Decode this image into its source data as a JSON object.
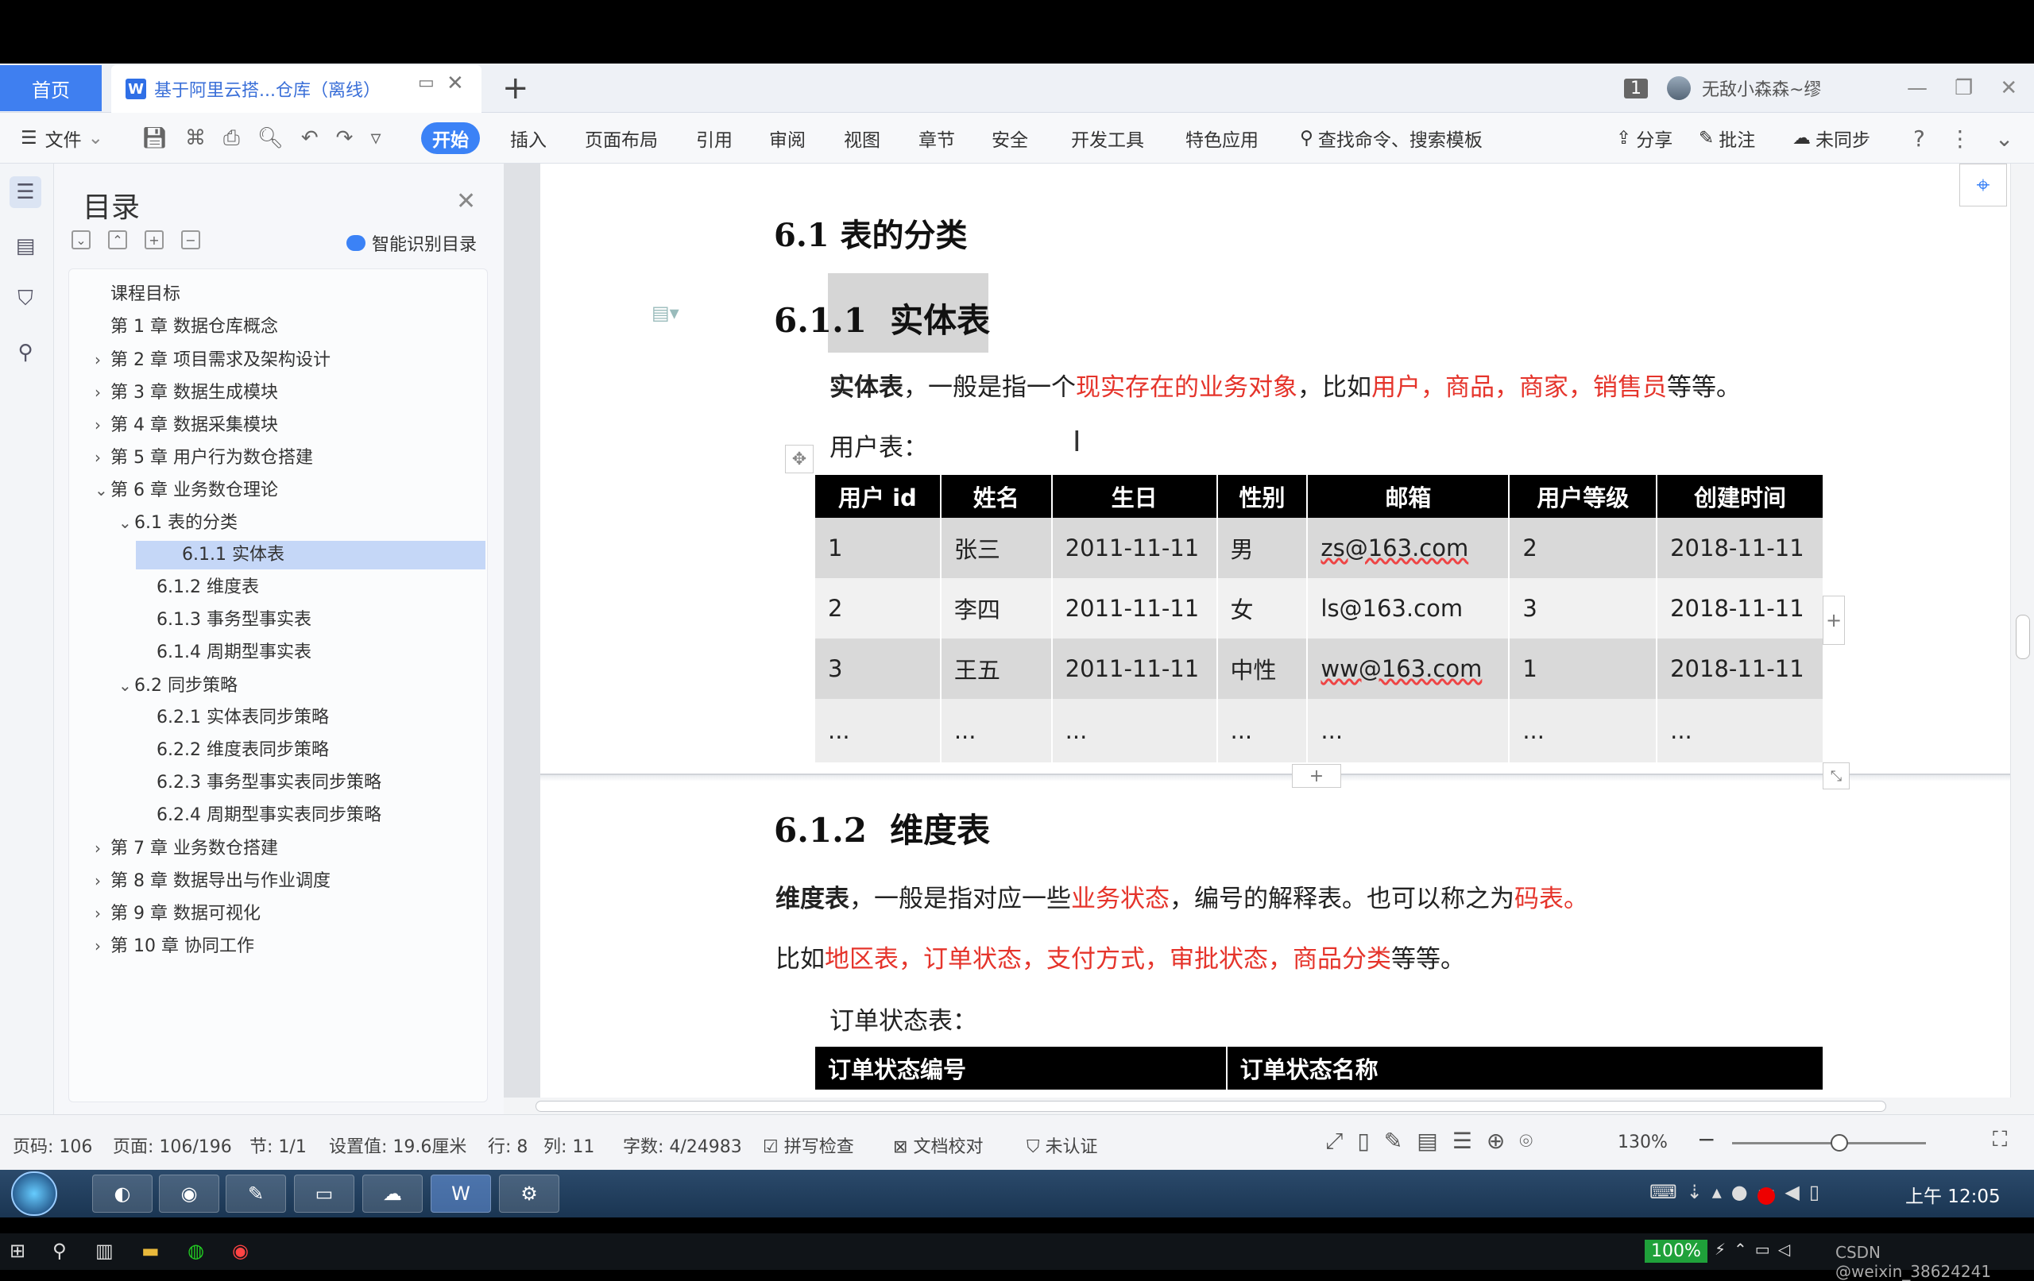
{
  "tabs": {
    "home": "首页",
    "doc": "基于阿里云搭...仓库（离线）",
    "new": "+"
  },
  "window": {
    "badge": "1",
    "user": "无敌小森森~缪"
  },
  "toolbar": {
    "file": "文件",
    "items": [
      "开始",
      "插入",
      "页面布局",
      "引用",
      "审阅",
      "视图",
      "章节",
      "安全",
      "开发工具",
      "特色应用"
    ],
    "search": "查找命令、搜索模板",
    "share": "分享",
    "comment": "批注",
    "sync": "未同步"
  },
  "toc": {
    "title": "目录",
    "smart": "智能识别目录",
    "items": [
      {
        "label": "课程目标",
        "level": 0,
        "arrow": ""
      },
      {
        "label": "第 1 章  数据仓库概念",
        "level": 0,
        "arrow": ""
      },
      {
        "label": "第 2 章  项目需求及架构设计",
        "level": 0,
        "arrow": "›"
      },
      {
        "label": "第 3 章  数据生成模块",
        "level": 0,
        "arrow": "›"
      },
      {
        "label": "第 4 章  数据采集模块",
        "level": 0,
        "arrow": "›"
      },
      {
        "label": "第 5 章  用户行为数仓搭建",
        "level": 0,
        "arrow": "›"
      },
      {
        "label": "第 6 章  业务数仓理论",
        "level": 0,
        "arrow": "⌄"
      },
      {
        "label": "6.1  表的分类",
        "level": 1,
        "arrow": "⌄"
      },
      {
        "label": "6.1.1  实体表",
        "level": 2,
        "arrow": ""
      },
      {
        "label": "6.1.2  维度表",
        "level": 2,
        "arrow": ""
      },
      {
        "label": "6.1.3  事务型事实表",
        "level": 2,
        "arrow": ""
      },
      {
        "label": "6.1.4  周期型事实表",
        "level": 2,
        "arrow": ""
      },
      {
        "label": "6.2  同步策略",
        "level": 1,
        "arrow": "⌄"
      },
      {
        "label": "6.2.1  实体表同步策略",
        "level": 2,
        "arrow": ""
      },
      {
        "label": "6.2.2  维度表同步策略",
        "level": 2,
        "arrow": ""
      },
      {
        "label": "6.2.3  事务型事实表同步策略",
        "level": 2,
        "arrow": ""
      },
      {
        "label": "6.2.4  周期型事实表同步策略",
        "level": 2,
        "arrow": ""
      },
      {
        "label": "第 7 章  业务数仓搭建",
        "level": 0,
        "arrow": "›"
      },
      {
        "label": "第 8 章  数据导出与作业调度",
        "level": 0,
        "arrow": "›"
      },
      {
        "label": "第 9 章  数据可视化",
        "level": 0,
        "arrow": "›"
      },
      {
        "label": "第 10 章  协同工作",
        "level": 0,
        "arrow": "›"
      }
    ],
    "selected_index": 8
  },
  "doc": {
    "h_61": "6.1  表的分类",
    "h_611_num": "6.1.1",
    "h_611_txt": "实体表",
    "p1": {
      "b": "实体表",
      "t1": "，一般是指一个",
      "r1": "现实存在的业务对象",
      "t2": "，比如",
      "r2": "用户，商品，商家，销售员",
      "t3": "等等。"
    },
    "user_table_label": "用户表：",
    "user_table": {
      "headers": [
        "用户 id",
        "姓名",
        "生日",
        "性别",
        "邮箱",
        "用户等级",
        "创建时间"
      ],
      "rows": [
        [
          "1",
          "张三",
          "2011-11-11",
          "男",
          "zs@163.com",
          "2",
          "2018-11-11"
        ],
        [
          "2",
          "李四",
          "2011-11-11",
          "女",
          "ls@163.com",
          "3",
          "2018-11-11"
        ],
        [
          "3",
          "王五",
          "2011-11-11",
          "中性",
          "ww@163.com",
          "1",
          "2018-11-11"
        ],
        [
          "...",
          "...",
          "...",
          "...",
          "...",
          "...",
          "..."
        ]
      ]
    },
    "h_612_num": "6.1.2",
    "h_612_txt": "维度表",
    "p2": {
      "b": "维度表",
      "t1": "，一般是指对应一些",
      "r1": "业务状态",
      "t2": "，编号的解释表。也可以称之为",
      "r2": "码表。"
    },
    "p3": {
      "t1": "比如",
      "r1": "地区表，订单状态，支付方式，审批状态，商品分类",
      "t2": "等等。"
    },
    "order_table_label": "订单状态表：",
    "order_table": {
      "headers": [
        "订单状态编号",
        "订单状态名称"
      ]
    }
  },
  "status": {
    "page_code": "页码: 106",
    "page": "页面: 106/196",
    "section": "节: 1/1",
    "setting": "设置值: 19.6厘米",
    "row": "行: 8",
    "col": "列: 11",
    "words": "字数: 4/24983",
    "spell": "拼写检查",
    "proof": "文档校对",
    "auth": "未认证",
    "zoom": "130%"
  },
  "taskbar": {
    "clock": "上午 12:05",
    "battery": "100%",
    "watermark": "CSDN @weixin_38624241"
  }
}
